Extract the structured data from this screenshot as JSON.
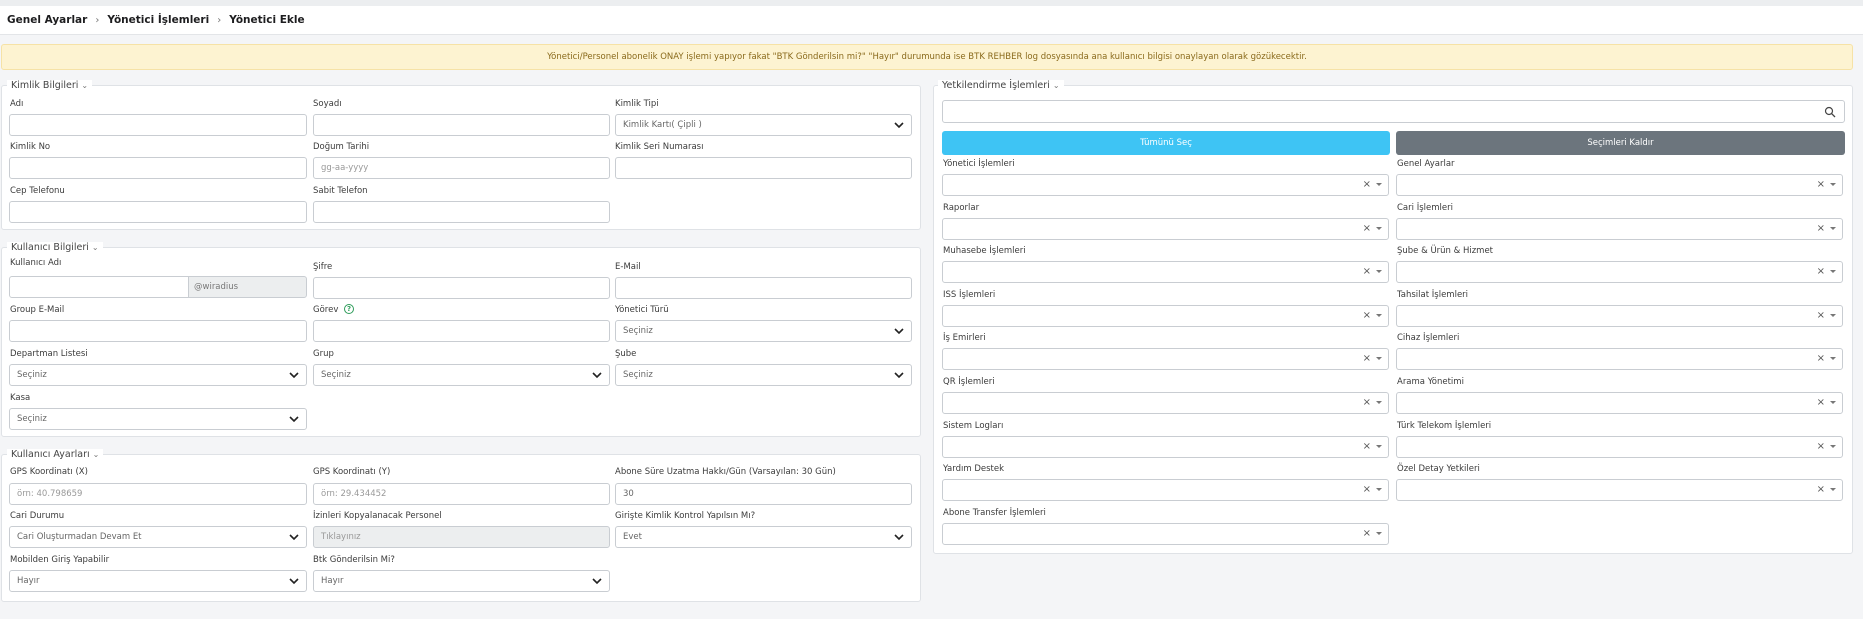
{
  "breadcrumb": [
    "Genel Ayarlar",
    "Yönetici İşlemleri",
    "Yönetici Ekle"
  ],
  "alert": "Yönetici/Personel abonelik ONAY işlemi yapıyor fakat \"BTK Gönderilsin mi?\" \"Hayır\" durumunda ise BTK REHBER log dosyasında ana kullanıcı bilgisi onaylayan olarak gözükecektir.",
  "kimlik": {
    "legend": "Kimlik Bilgileri",
    "adi": "Adı",
    "soyadi": "Soyadı",
    "kimlik_tipi": "Kimlik Tipi",
    "kimlik_tipi_value": "Kimlik Kartı( Çipli )",
    "kimlik_no": "Kimlik No",
    "dogum_tarihi": "Doğum Tarihi",
    "dogum_placeholder": "gg-aa-yyyy",
    "seri_no": "Kimlik Seri Numarası",
    "cep": "Cep Telefonu",
    "sabit": "Sabit Telefon"
  },
  "kullanici": {
    "legend": "Kullanıcı Bilgileri",
    "kullanici_adi": "Kullanıcı Adı",
    "domain_suffix": "@wiradius",
    "sifre": "Şifre",
    "email": "E-Mail",
    "group_email": "Group E-Mail",
    "gorev": "Görev",
    "yonetici_turu": "Yönetici Türü",
    "yonetici_turu_value": "Seçiniz",
    "departman": "Departman Listesi",
    "departman_value": "Seçiniz",
    "grup": "Grup",
    "grup_value": "Seçiniz",
    "sube": "Şube",
    "sube_value": "Seçiniz",
    "kasa": "Kasa",
    "kasa_value": "Seçiniz"
  },
  "ayarlar": {
    "legend": "Kullanıcı Ayarları",
    "gps_x": "GPS Koordinatı (X)",
    "gps_x_placeholder": "örn: 40.798659",
    "gps_y": "GPS Koordinatı (Y)",
    "gps_y_placeholder": "örn: 29.434452",
    "uzatma": "Abone Süre Uzatma Hakkı/Gün (Varsayılan: 30 Gün)",
    "uzatma_value": "30",
    "cari_durumu": "Cari Durumu",
    "cari_durumu_value": "Cari Oluşturmadan Devam Et",
    "izinleri": "İzinleri Kopyalanacak Personel",
    "izinleri_value": "Tıklayınız",
    "giriste_kimlik": "Girişte Kimlik Kontrol Yapılsın Mı?",
    "giriste_kimlik_value": "Evet",
    "mobilden": "Mobilden Giriş Yapabilir",
    "mobilden_value": "Hayır",
    "btk": "Btk Gönderilsin Mi?",
    "btk_value": "Hayır"
  },
  "yetki": {
    "legend": "Yetkilendirme İşlemleri",
    "select_all": "Tümünü Seç",
    "clear": "Seçimleri Kaldır",
    "groups": [
      "Yönetici İşlemleri",
      "Genel Ayarlar",
      "Raporlar",
      "Cari İşlemleri",
      "Muhasebe İşlemleri",
      "Şube & Ürün & Hizmet",
      "ISS İşlemleri",
      "Tahsilat İşlemleri",
      "İş Emirleri",
      "Cihaz İşlemleri",
      "QR İşlemleri",
      "Arama Yönetimi",
      "Sistem Logları",
      "Türk Telekom İşlemleri",
      "Yardım Destek",
      "Özel Detay Yetkileri",
      "Abone Transfer İşlemleri"
    ]
  }
}
